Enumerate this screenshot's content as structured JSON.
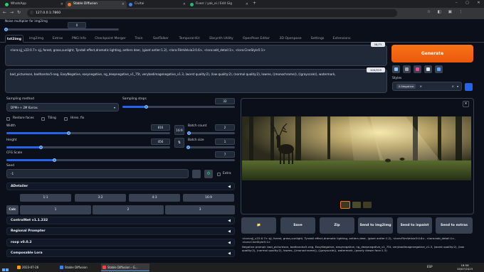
{
  "browser": {
    "tabs": [
      {
        "label": "WhatsApp",
        "color": "#25d366"
      },
      {
        "label": "Stable Diffusion",
        "color": "#f97316"
      },
      {
        "label": "Civitai",
        "color": "#3b82f6"
      },
      {
        "label": "Fiverr / yak_ei / Edit Gig",
        "color": "#1dbf73"
      }
    ],
    "url": "127.0.0.1:7860"
  },
  "top_strip": {
    "label": "Noise multiplier for img2img",
    "value": "0"
  },
  "tabs": [
    "txt2img",
    "img2img",
    "Extras",
    "PNG Info",
    "Checkpoint Merger",
    "Train",
    "SadTalker",
    "Temporal-Kit",
    "Ebsynth Utility",
    "OpenPose Editor",
    "3D Openpose",
    "Settings",
    "Extensions"
  ],
  "positive_prompt": {
    "text": "<lora:sjj_v22:0.7> sjj, forest, grass,sunlight, Tyndall effect,dramatic lighting, antlers deer, (giant antler:1.2), <lora:FilmVelvia3:0.6>, <lora:add_detail:1>, <lora:CineStyle5:1>",
    "counter": "38/75"
  },
  "negative_prompt": {
    "text": "bad_pictureson, badhandsv5-neg, EasyNegative, easynegative, ng_deepnegative_v1_75t, verybadimagenegative_v1.3, (worst quality:2), (low quality:2), (normal quality:2), lowres, ((monochrome)), ((grayscale)), watermark,",
    "counter": "104/225"
  },
  "generate_label": "Generate",
  "styles": {
    "label": "Styles",
    "selected": "0-Negative"
  },
  "sampling": {
    "method_label": "Sampling method",
    "method_value": "DPM++ 2M Karras",
    "steps_label": "Sampling steps",
    "steps_value": "32",
    "steps_fraction": 0.21
  },
  "checkboxes": [
    "Restore faces",
    "Tiling",
    "Hires. fix"
  ],
  "width": {
    "label": "Width",
    "value": "816",
    "fraction": 0.38
  },
  "height": {
    "label": "Height",
    "value": "456",
    "fraction": 0.21
  },
  "ratio_badge": "16:9",
  "swap_icon": "swap-icon",
  "batch_count": {
    "label": "Batch count",
    "value": "2",
    "fraction": 0.02
  },
  "batch_size": {
    "label": "Batch size",
    "value": "1",
    "fraction": 0.0
  },
  "cfg": {
    "label": "CFG Scale",
    "value": "7",
    "fraction": 0.21
  },
  "seed": {
    "label": "Seed",
    "value": "-1",
    "extra_label": "Extra"
  },
  "adetailer": {
    "title": "ADetailer"
  },
  "ratios": [
    "1:1",
    "3:2",
    "4:3",
    "16:9"
  ],
  "calc_label": "Calc",
  "multipliers": [
    "1",
    "2",
    "3"
  ],
  "accordions": [
    "ControlNet v1.1.232",
    "Regional Prompter",
    "roop v0.0.2",
    "Composable Lora"
  ],
  "output_buttons": [
    "📁",
    "Save",
    "Zip",
    "Send to img2img",
    "Send to inpaint",
    "Send to extras"
  ],
  "info_text": {
    "prompt": "<lora:sjj_v22:0.7> sjj, forest, grass,sunlight, Tyndall effect,dramatic lighting, antlers deer, (giant antler:1.2), <lora:FilmVelvia3:0.6>, <lora:add_detail:1>, <lora:CineStyle5:1>",
    "negative": "Negative prompt: bad_pictureson, badhandsv5-neg, EasyNegative, easynegative, ng_deepnegative_v1_75t, verybadimagenegative_v1.3, (worst quality:2), (low quality:2), (normal quality:2), lowres, ((monochrome)), ((grayscale)), watermark, (poorly drawn face:1.3)"
  },
  "taskbar": {
    "items": [
      {
        "label": "2023-07-26",
        "color": "#f59e0b"
      },
      {
        "label": "Stable Diffusion",
        "color": "#3b82f6"
      },
      {
        "label": "Stable Diffusion - G...",
        "color": "#ef4444"
      }
    ],
    "time": "18:58",
    "date": "18/07/2023",
    "lang": "ESP"
  },
  "colors": {
    "accent": "#2563eb",
    "generate": "#f97316",
    "background": "#0b0f19"
  }
}
